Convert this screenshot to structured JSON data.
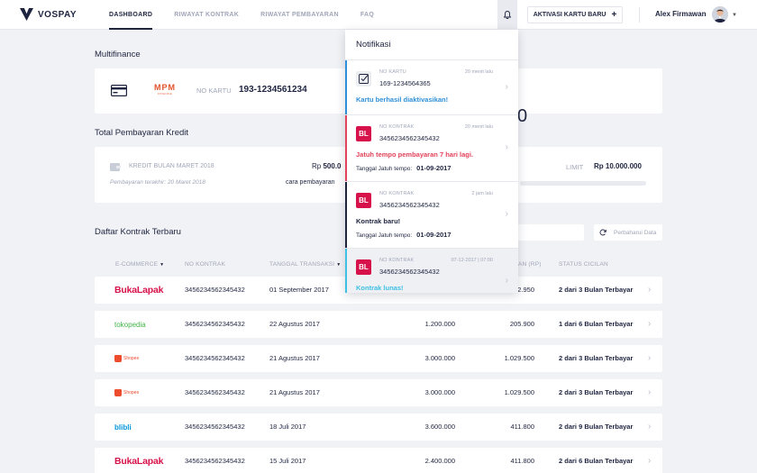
{
  "brand": {
    "name": "VOSPAY"
  },
  "nav": [
    {
      "label": "DASHBOARD",
      "active": true
    },
    {
      "label": "RIWAYAT KONTRAK",
      "active": false
    },
    {
      "label": "RIWAYAT PEMBAYARAN",
      "active": false
    },
    {
      "label": "FAQ",
      "active": false
    }
  ],
  "header": {
    "activate_label": "AKTIVASI KARTU BARU",
    "user_name": "Alex Firmawan"
  },
  "multifinance": {
    "title": "Multifinance",
    "partner": "MPM",
    "partner_sub": "FINANCE",
    "card_label": "NO KARTU",
    "card_number": "193-1234561234",
    "partial_amount": "0"
  },
  "total": {
    "title": "Total Pembayaran Kredit",
    "kredit_label": "KREDIT BULAN MARET 2018",
    "kredit_rp": "Rp",
    "kredit_amount": "500.0",
    "last_payment": "Pembayaran terakhir: 20 Maret 2018",
    "cara_label": "cara pembayaran",
    "limit_label": "LIMIT",
    "limit_value": "Rp 10.000.000"
  },
  "contracts": {
    "title": "Daftar Kontrak Terbaru",
    "refresh_label": "Perbaharui Data",
    "columns": {
      "ecommerce": "E-COMMERCE",
      "no_kontrak": "NO KONTRAK",
      "tanggal": "TANGGAL TRANSAKSI",
      "cicilan_partial": "AN (RP)",
      "status": "STATUS CICILAN"
    },
    "rows": [
      {
        "brand": "BukaLapak",
        "no": "3456234562345432",
        "date": "01 September 2017",
        "amount": "",
        "cicilan": "2.950",
        "status": "2 dari 3 Bulan Terbayar"
      },
      {
        "brand": "tokopedia",
        "no": "3456234562345432",
        "date": "22 Agustus 2017",
        "amount": "1.200.000",
        "cicilan": "205.900",
        "status": "1 dari 6 Bulan Terbayar"
      },
      {
        "brand": "Shopee",
        "no": "3456234562345432",
        "date": "21 Agustus 2017",
        "amount": "3.000.000",
        "cicilan": "1.029.500",
        "status": "2 dari 3 Bulan Terbayar"
      },
      {
        "brand": "Shopee",
        "no": "3456234562345432",
        "date": "21 Agustus 2017",
        "amount": "3.000.000",
        "cicilan": "1.029.500",
        "status": "2 dari 3 Bulan Terbayar"
      },
      {
        "brand": "blibli",
        "no": "3456234562345432",
        "date": "18 Juli 2017",
        "amount": "3.600.000",
        "cicilan": "411.800",
        "status": "2 dari 9 Bulan Terbayar"
      },
      {
        "brand": "BukaLapak",
        "no": "3456234562345432",
        "date": "15 Juli 2017",
        "amount": "2.400.000",
        "cicilan": "411.800",
        "status": "2 dari 6 Bulan Terbayar"
      }
    ]
  },
  "notifications": {
    "title": "Notifikasi",
    "items": [
      {
        "icon": "card-check-icon",
        "label": "NO KARTU",
        "time": "20 menit lalu",
        "number": "169-1234564365",
        "message": "Kartu berhasil diaktivasikan!",
        "message_color": "#2f8fd8",
        "bar_color": "#2f8fd8",
        "due_label": "",
        "due_date": ""
      },
      {
        "icon": "bukalapak-icon",
        "icon_text": "BL",
        "label": "NO KONTRAK",
        "time": "20 menit lalu",
        "number": "3456234562345432",
        "message": "Jatuh tempo pembayaran 7 hari lagi.",
        "message_color": "#e2435a",
        "bar_color": "#e2435a",
        "due_label": "Tanggal Jatuh tempo:",
        "due_date": "01-09-2017"
      },
      {
        "icon": "bukalapak-icon",
        "icon_text": "BL",
        "label": "NO KONTRAK",
        "time": "2 jam lalu",
        "number": "3456234562345432",
        "message": "Kontrak baru!",
        "message_color": "#1e2440",
        "bar_color": "#1e2440",
        "due_label": "Tanggal Jatuh tempo:",
        "due_date": "01-09-2017"
      },
      {
        "icon": "bukalapak-icon",
        "icon_text": "BL",
        "label": "NO KONTRAK",
        "time": "07-12-2017 | 07:00",
        "number": "3456234562345432",
        "message": "Kontrak lunas!",
        "message_color": "#3ec0e3",
        "bar_color": "#3ec0e3",
        "due_label": "",
        "due_date": ""
      }
    ]
  }
}
